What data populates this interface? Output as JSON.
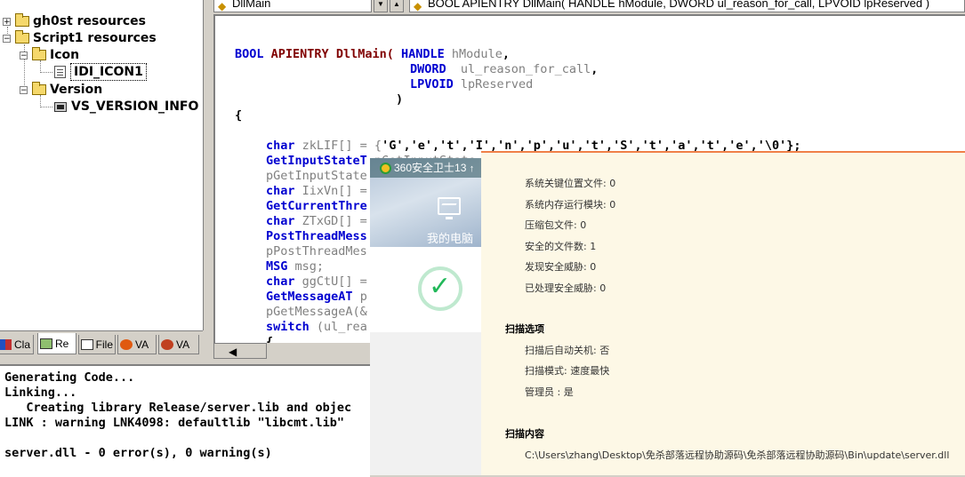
{
  "tree": {
    "items": [
      {
        "label": "gh0st resources",
        "expander": "+"
      },
      {
        "label": "Script1 resources",
        "expander": "−"
      },
      {
        "label": "Icon",
        "expander": "−"
      },
      {
        "label": "IDI_ICON1"
      },
      {
        "label": "Version",
        "expander": "−"
      },
      {
        "label": "VS_VERSION_INFO"
      }
    ]
  },
  "workspace_tabs": [
    {
      "label": "Cla",
      "icon": "classview-icon"
    },
    {
      "label": "Re",
      "icon": "resourceview-icon"
    },
    {
      "label": "File",
      "icon": "fileview-icon"
    },
    {
      "label": "VA",
      "icon": "va-view-icon"
    },
    {
      "label": "VA",
      "icon": "va-outline-icon"
    }
  ],
  "editor_toolbar": {
    "function_combo": "DllMain",
    "signature_combo": "BOOL APIENTRY DllMain( HANDLE hModule, DWORD ul_reason_for_call, LPVOID lpReserved )"
  },
  "code": {
    "l1": {
      "t1": "BOOL",
      "t2": "APIENTRY",
      "t3": "DllMain(",
      "t4": "HANDLE",
      "t5": "hModule",
      "t6": ","
    },
    "l2": {
      "t1": "DWORD",
      "t2": "ul_reason_for_call",
      "t3": ","
    },
    "l3": {
      "t1": "LPVOID",
      "t2": "lpReserved"
    },
    "l4": ")",
    "l5": "{",
    "l6": {
      "t1": "char",
      "t2": "zkLIF[] = {",
      "t3": "'G','e','t','I','n','p','u','t','S','t','a','t','e','\\0'};"
    },
    "l7": {
      "t1": "GetInputStateT",
      "t2": "pGetInputState"
    },
    "l8": "pGetInputState",
    "l9": {
      "t1": "char",
      "t2": "IixVn[] ="
    },
    "l10": "GetCurrentThre",
    "l11": {
      "t1": "char",
      "t2": "ZTxGD[] ="
    },
    "l12": "PostThreadMess",
    "l13": "pPostThreadMes",
    "l14": {
      "t1": "MSG",
      "t2": "msg;"
    },
    "l15": {
      "t1": "char",
      "t2": "ggCtU[] ="
    },
    "l16": {
      "t1": "GetMessageAT",
      "t2": "p"
    },
    "l17": {
      "t1": "pGetMessageA(&",
      "t2": ""
    },
    "l18": {
      "t1": "switch",
      "t2": "(ul_rea"
    },
    "l19": "{"
  },
  "output": {
    "lines": [
      "Generating Code...",
      "Linking...",
      "   Creating library Release/server.lib and objec",
      "LINK : warning LNK4098: defaultlib \"libcmt.lib\"",
      "",
      "server.dll - 0 error(s), 0 warning(s)"
    ]
  },
  "popup360": {
    "title": "360安全卫士13",
    "title_arrow": "↑",
    "nav_label": "我的电脑",
    "accent": "#22b85a"
  },
  "report": {
    "accent": "#f08048",
    "stats": [
      "系统关键位置文件: 0",
      "系统内存运行模块: 0",
      "压缩包文件: 0",
      "安全的文件数: 1",
      "发现安全威胁: 0",
      "已处理安全威胁: 0"
    ],
    "options_heading": "扫描选项",
    "options": [
      "扫描后自动关机: 否",
      "扫描模式: 速度最快",
      "管理员 : 是"
    ],
    "content_heading": "扫描内容",
    "content_path": "C:\\Users\\zhang\\Desktop\\免杀部落远程协助源码\\免杀部落远程协助源码\\Bin\\update\\server.dll"
  }
}
